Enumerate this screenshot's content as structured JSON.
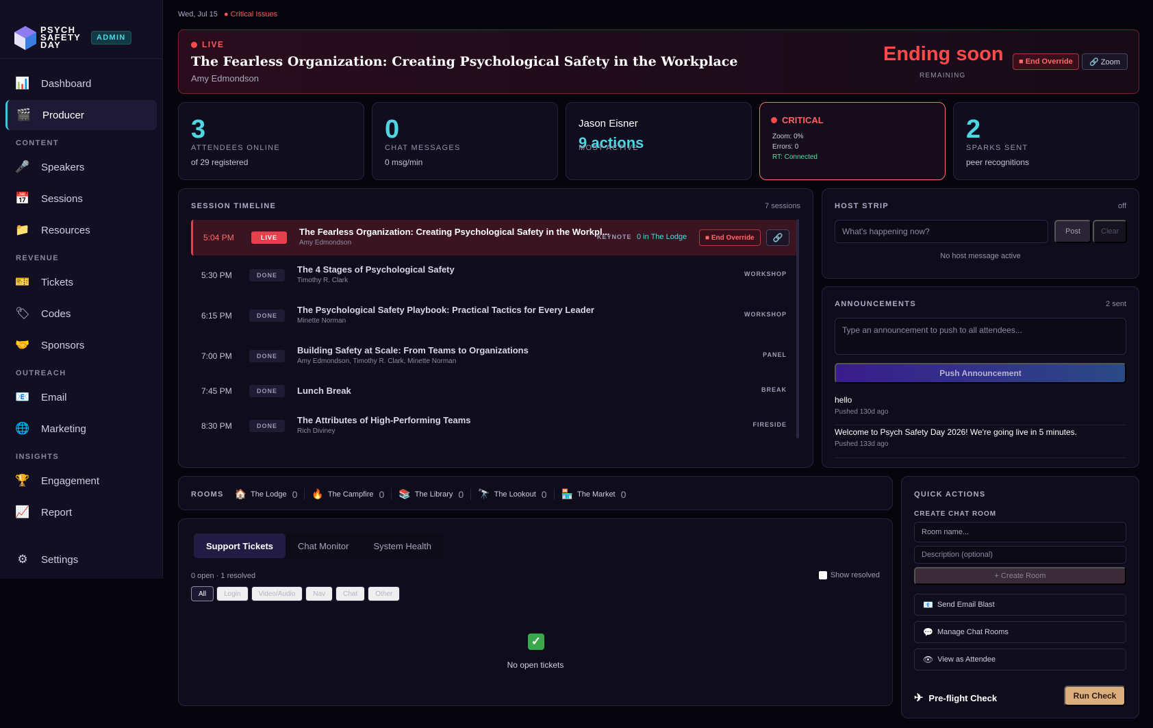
{
  "brand": {
    "name_line1": "PSYCH",
    "name_line2": "SAFETY",
    "name_line3": "DAY",
    "badge": "ADMIN",
    "logo_icon": "cube-logo-icon"
  },
  "sidebar": {
    "items": [
      {
        "label": "Dashboard",
        "icon": "📊",
        "icon_name": "bar-chart-icon"
      },
      {
        "label": "Producer",
        "icon": "🎬",
        "icon_name": "clapperboard-icon"
      }
    ],
    "sections": [
      {
        "title": "CONTENT",
        "items": [
          {
            "label": "Speakers",
            "icon": "🎤",
            "icon_name": "microphone-icon"
          },
          {
            "label": "Sessions",
            "icon": "📅",
            "icon_name": "calendar-icon"
          },
          {
            "label": "Resources",
            "icon": "📁",
            "icon_name": "folder-icon"
          }
        ]
      },
      {
        "title": "REVENUE",
        "items": [
          {
            "label": "Tickets",
            "icon": "🎫",
            "icon_name": "ticket-icon"
          },
          {
            "label": "Codes",
            "icon": "🏷",
            "icon_name": "tag-icon"
          },
          {
            "label": "Sponsors",
            "icon": "🤝",
            "icon_name": "handshake-icon"
          }
        ]
      },
      {
        "title": "OUTREACH",
        "items": [
          {
            "label": "Email",
            "icon": "📧",
            "icon_name": "email-icon"
          },
          {
            "label": "Marketing",
            "icon": "🌐",
            "icon_name": "globe-icon"
          }
        ]
      },
      {
        "title": "INSIGHTS",
        "items": [
          {
            "label": "Engagement",
            "icon": "🏆",
            "icon_name": "trophy-icon"
          },
          {
            "label": "Report",
            "icon": "📈",
            "icon_name": "trend-chart-icon"
          }
        ]
      }
    ],
    "settings": {
      "label": "Settings",
      "icon": "⚙",
      "icon_name": "gear-icon"
    }
  },
  "topline": {
    "date": "Wed, Jul 15",
    "critical": "● Critical Issues"
  },
  "live": {
    "tag": "LIVE",
    "title": "The Fearless Organization: Creating Psychological Safety in the Workplace",
    "speaker": "Amy Edmondson",
    "ending": "Ending soon",
    "remaining": "REMAINING",
    "override_label": "■ End Override",
    "zoom_label": "🔗 Zoom"
  },
  "stats": {
    "attendees": {
      "value": "3",
      "label": "ATTENDEES ONLINE",
      "sub": "of 29 registered"
    },
    "chat": {
      "value": "0",
      "label": "CHAT MESSAGES",
      "sub": "0 msg/min"
    },
    "active": {
      "name": "Jason Eisner",
      "actions": "9 actions",
      "label": "MOST ACTIVE"
    },
    "health": {
      "title": "CRITICAL",
      "zoom": "Zoom: 0%",
      "errors": "Errors: 0",
      "rt": "RT: Connected"
    },
    "sparks": {
      "value": "2",
      "label": "SPARKS SENT",
      "sub": "peer recognitions"
    }
  },
  "timeline": {
    "title": "SESSION TIMELINE",
    "count": "7 sessions",
    "live_row": {
      "time": "5:04 PM",
      "status": "LIVE",
      "title": "The Fearless Organization: Creating Psychological Safety in the Workpl...",
      "speaker": "Amy Edmondson",
      "type": "KEYNOTE",
      "lodge": "0 in The Lodge",
      "override": "■ End Override",
      "link_icon": "🔗"
    },
    "rows": [
      {
        "time": "5:30 PM",
        "status": "DONE",
        "title": "The 4 Stages of Psychological Safety",
        "speaker": "Timothy R. Clark",
        "type": "WORKSHOP"
      },
      {
        "time": "6:15 PM",
        "status": "DONE",
        "title": "The Psychological Safety Playbook: Practical Tactics for Every Leader",
        "speaker": "Minette Norman",
        "type": "WORKSHOP"
      },
      {
        "time": "7:00 PM",
        "status": "DONE",
        "title": "Building Safety at Scale: From Teams to Organizations",
        "speaker": "Amy Edmondson, Timothy R. Clark, Minette Norman",
        "type": "PANEL"
      },
      {
        "time": "7:45 PM",
        "status": "DONE",
        "title": "Lunch Break",
        "speaker": "",
        "type": "BREAK"
      },
      {
        "time": "8:30 PM",
        "status": "DONE",
        "title": "The Attributes of High-Performing Teams",
        "speaker": "Rich Diviney",
        "type": "FIRESIDE"
      }
    ]
  },
  "hoststrip": {
    "title": "HOST STRIP",
    "state": "off",
    "placeholder": "What's happening now?",
    "post": "Post",
    "clear": "Clear",
    "empty": "No host message active"
  },
  "announcements": {
    "title": "ANNOUNCEMENTS",
    "count": "2 sent",
    "placeholder": "Type an announcement to push to all attendees...",
    "push": "Push Announcement",
    "items": [
      {
        "text": "hello",
        "meta": "Pushed 130d ago"
      },
      {
        "text": "Welcome to Psych Safety Day 2026! We're going live in 5 minutes.",
        "meta": "Pushed 133d ago"
      }
    ]
  },
  "rooms": {
    "label": "ROOMS",
    "items": [
      {
        "name": "The Lodge",
        "count": "0",
        "icon": "🏠"
      },
      {
        "name": "The Campfire",
        "count": "0",
        "icon": "🔥"
      },
      {
        "name": "The Library",
        "count": "0",
        "icon": "📚"
      },
      {
        "name": "The Lookout",
        "count": "0",
        "icon": "🔭"
      },
      {
        "name": "The Market",
        "count": "0",
        "icon": "🏪"
      }
    ]
  },
  "support": {
    "tabs": [
      "Support Tickets",
      "Chat Monitor",
      "System Health"
    ],
    "meta": "0 open · 1 resolved",
    "show_resolved": "Show resolved",
    "chips": [
      "All",
      "Login",
      "Video/Audio",
      "Nav",
      "Chat",
      "Other"
    ],
    "empty_icon": "✓",
    "empty": "No open tickets"
  },
  "quick": {
    "title": "QUICK ACTIONS",
    "subtitle": "CREATE CHAT ROOM",
    "room_placeholder": "Room name...",
    "desc_placeholder": "Description (optional)",
    "create": "+ Create Room",
    "actions": [
      {
        "label": "Send Email Blast",
        "icon": "📧"
      },
      {
        "label": "Manage Chat Rooms",
        "icon": "💬"
      },
      {
        "label": "View as Attendee",
        "icon": "👁"
      }
    ],
    "preflight": "Pre-flight Check",
    "preflight_icon": "✈",
    "run": "Run Check"
  }
}
